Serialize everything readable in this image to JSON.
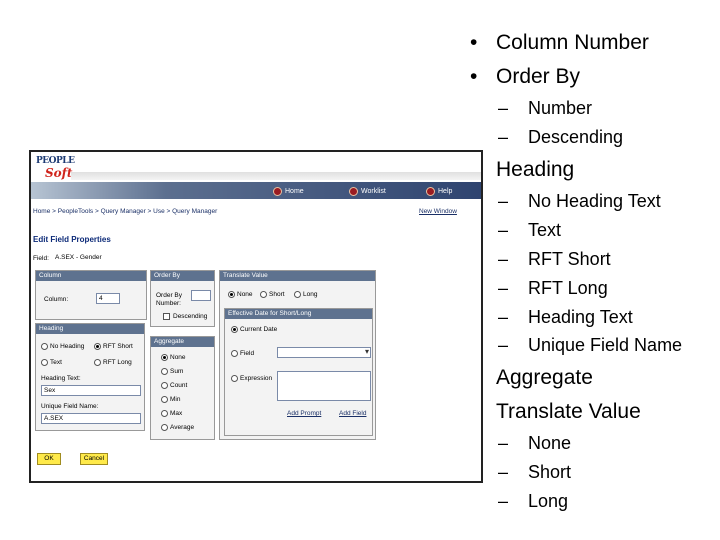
{
  "bullets": {
    "column_number": "Column Number",
    "order_by": "Order By",
    "number": "Number",
    "descending": "Descending",
    "heading": "Heading",
    "no_heading_text": "No Heading Text",
    "text": "Text",
    "rft_short": "RFT Short",
    "rft_long": "RFT Long",
    "heading_text": "Heading Text",
    "unique_field_name": "Unique Field Name",
    "aggregate": "Aggregate",
    "translate_value": "Translate Value",
    "none": "None",
    "short": "Short",
    "long": "Long",
    "bullet_glyph": "•",
    "dash_glyph": "–"
  },
  "app": {
    "logo_top": "PEOPLE",
    "logo_bottom": "Soft",
    "nav": {
      "home": "Home",
      "worklist": "Worklist",
      "help": "Help"
    },
    "breadcrumb": "Home > PeopleTools > Query Manager > Use > Query Manager",
    "new_window": "New Window",
    "page_title": "Edit Field Properties",
    "field_label": "Field:",
    "field_value": "A.SEX - Gender",
    "column": {
      "header": "Column",
      "label": "Column:",
      "value": "4"
    },
    "order_by": {
      "header": "Order By",
      "label_line1": "Order By",
      "label_line2": "Number:",
      "descending": "Descending"
    },
    "translate_value": {
      "header": "Translate Value",
      "none": "None",
      "short": "Short",
      "long": "Long"
    },
    "effective_date": {
      "header": "Effective Date for Short/Long",
      "current_date": "Current Date",
      "field": "Field",
      "expression": "Expression",
      "add_prompt": "Add Prompt",
      "add_field": "Add Field"
    },
    "heading": {
      "header": "Heading",
      "no_heading": "No Heading",
      "rft_short": "RFT Short",
      "text": "Text",
      "rft_long": "RFT Long",
      "heading_text_label": "Heading Text:",
      "heading_text_value": "Sex",
      "unique_field_name_label": "Unique Field Name:",
      "unique_field_name_value": "A.SEX"
    },
    "aggregate": {
      "header": "Aggregate",
      "options": [
        "None",
        "Sum",
        "Count",
        "Min",
        "Max",
        "Average"
      ]
    },
    "ok_button": "OK",
    "cancel_button": "Cancel"
  }
}
